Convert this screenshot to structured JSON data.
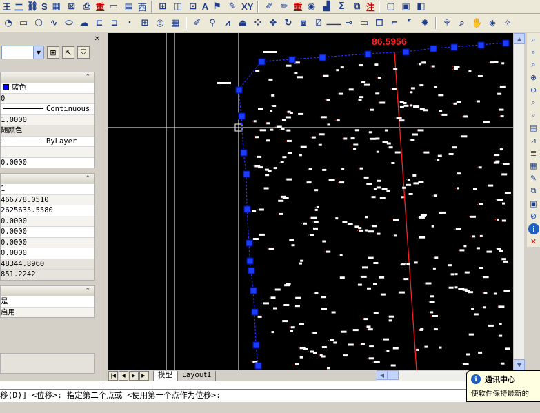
{
  "toolbar_top": {
    "labels": [
      "二",
      "迓",
      "S",
      "图",
      "重",
      "西",
      "A",
      "XY",
      "重",
      "注"
    ]
  },
  "toolbar_draw": {
    "labels": [
      "A"
    ]
  },
  "properties": {
    "section_general": [
      {
        "kind": "color",
        "text": "蓝色",
        "color": "#0000ff"
      },
      {
        "kind": "text",
        "text": "0"
      },
      {
        "kind": "linetype",
        "text": "Continuous"
      },
      {
        "kind": "text",
        "text": "1.0000"
      },
      {
        "kind": "text",
        "text": "随颜色"
      },
      {
        "kind": "linetype",
        "text": "ByLayer"
      },
      {
        "kind": "text",
        "text": ""
      },
      {
        "kind": "text",
        "text": "0.0000"
      }
    ],
    "section_geometry": [
      "1",
      "466778.0510",
      "2625635.5580",
      "0.0000",
      "0.0000",
      "0.0000",
      "0.0000",
      "48344.8960",
      "851.2242"
    ],
    "section_misc": [
      "是",
      "启用"
    ]
  },
  "drawing": {
    "dimension_text": "86.5956",
    "colors": {
      "background": "#000000",
      "polyline": "#2a2aff",
      "grip": "#1a3cff",
      "dimension": "#ff2020",
      "crosshair": "#ffffff",
      "points": "#ffffff"
    }
  },
  "tabs": {
    "model": "模型",
    "layout1": "Layout1"
  },
  "command": {
    "line": "移(D)] <位移>:   指定第二个点或 <使用第一个点作为位移>:"
  },
  "notice": {
    "title": "通讯中心",
    "body": "使软件保持最新的"
  }
}
